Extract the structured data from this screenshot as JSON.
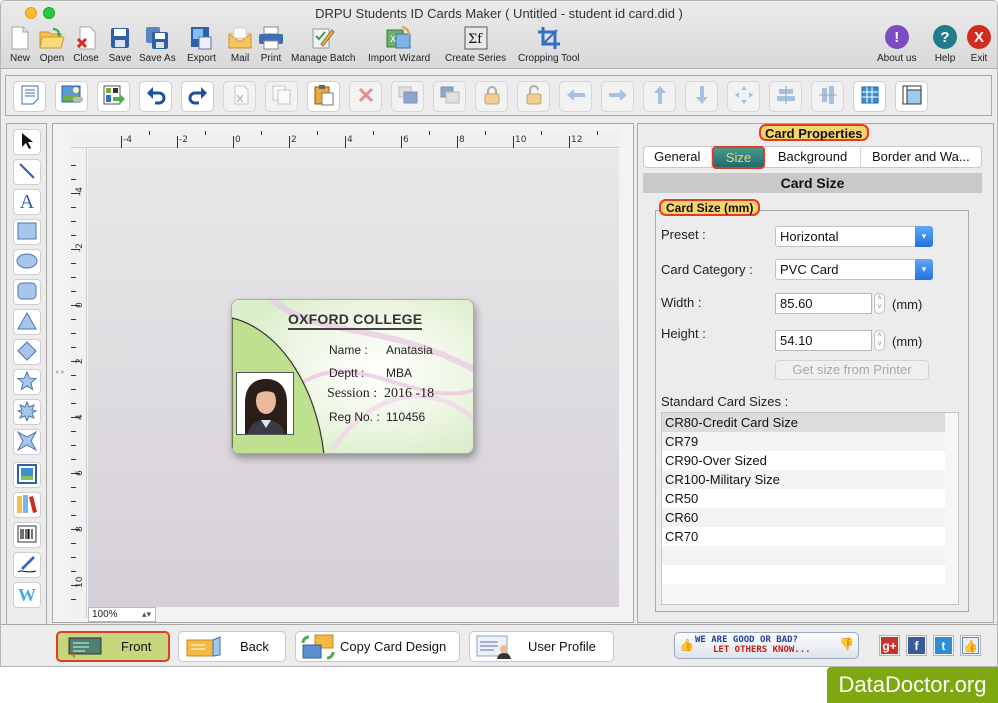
{
  "window": {
    "title": "DRPU Students ID Cards Maker ( Untitled - student id card.did )"
  },
  "main_toolbar": {
    "items": [
      {
        "label": "New",
        "icon": "new-document-icon"
      },
      {
        "label": "Open",
        "icon": "open-folder-icon"
      },
      {
        "label": "Close",
        "icon": "close-document-icon"
      },
      {
        "label": "Save",
        "icon": "save-icon"
      },
      {
        "label": "Save As",
        "icon": "save-as-icon"
      },
      {
        "label": "Export",
        "icon": "export-icon"
      },
      {
        "label": "Mail",
        "icon": "mail-icon"
      },
      {
        "label": "Print",
        "icon": "printer-icon"
      },
      {
        "label": "Manage Batch",
        "icon": "manage-batch-icon"
      },
      {
        "label": "Import Wizard",
        "icon": "import-wizard-icon"
      },
      {
        "label": "Create Series",
        "icon": "create-series-icon"
      },
      {
        "label": "Cropping Tool",
        "icon": "crop-icon"
      }
    ],
    "right_items": [
      {
        "label": "About us",
        "glyph": "!",
        "color": "#7d4cc2"
      },
      {
        "label": "Help",
        "glyph": "?",
        "color": "#237c8e"
      },
      {
        "label": "Exit",
        "glyph": "X",
        "color": "#d12b1f"
      }
    ]
  },
  "edit_toolbar": {
    "buttons": [
      {
        "name": "properties",
        "icon": "properties-icon",
        "enabled": true
      },
      {
        "name": "insert-image",
        "icon": "image-icon",
        "enabled": true
      },
      {
        "name": "export-design",
        "icon": "export-design-icon",
        "enabled": true
      },
      {
        "name": "undo",
        "icon": "undo-icon",
        "enabled": true
      },
      {
        "name": "redo",
        "icon": "redo-icon",
        "enabled": true
      },
      {
        "name": "cut",
        "icon": "cut-icon",
        "enabled": false
      },
      {
        "name": "copy",
        "icon": "copy-icon",
        "enabled": false
      },
      {
        "name": "paste",
        "icon": "paste-icon",
        "enabled": true
      },
      {
        "name": "delete",
        "icon": "delete-icon",
        "enabled": false
      },
      {
        "name": "bring-to-front",
        "icon": "bring-front-icon",
        "enabled": false
      },
      {
        "name": "send-to-back",
        "icon": "send-back-icon",
        "enabled": false
      },
      {
        "name": "lock",
        "icon": "lock-icon",
        "enabled": false
      },
      {
        "name": "unlock",
        "icon": "unlock-icon",
        "enabled": false
      },
      {
        "name": "move-left",
        "icon": "arrow-left-icon",
        "enabled": false
      },
      {
        "name": "move-right",
        "icon": "arrow-right-icon",
        "enabled": false
      },
      {
        "name": "move-up",
        "icon": "arrow-up-icon",
        "enabled": false
      },
      {
        "name": "move-down",
        "icon": "arrow-down-icon",
        "enabled": false
      },
      {
        "name": "center",
        "icon": "center-icon",
        "enabled": false
      },
      {
        "name": "align-horizontal",
        "icon": "align-horizontal-icon",
        "enabled": false
      },
      {
        "name": "align-vertical",
        "icon": "align-vertical-icon",
        "enabled": false
      },
      {
        "name": "grid",
        "icon": "grid-icon",
        "enabled": true
      },
      {
        "name": "ruler",
        "icon": "ruler-icon",
        "enabled": true
      }
    ]
  },
  "tools": [
    "pointer",
    "line",
    "text",
    "rectangle",
    "ellipse",
    "rounded-rectangle",
    "triangle",
    "diamond",
    "star",
    "burst",
    "four-point-star",
    "picture",
    "library",
    "barcode",
    "signature",
    "watermark"
  ],
  "canvas": {
    "ruler_h_labels": [
      "-4",
      "-2",
      "0",
      "2",
      "4",
      "6",
      "8",
      "10",
      "12"
    ],
    "ruler_v_labels": [
      "-4",
      "-2",
      "0",
      "2",
      "4",
      "6",
      "8",
      "10"
    ],
    "zoom": "100%"
  },
  "card": {
    "title": "OXFORD COLLEGE",
    "rows": [
      {
        "label": "Name :",
        "value": "Anatasia"
      },
      {
        "label": "Deptt :",
        "value": "MBA"
      },
      {
        "label": "Session :",
        "value": "2016 -18"
      },
      {
        "label": "Reg No. :",
        "value": "110456"
      }
    ]
  },
  "properties": {
    "title": "Card Properties",
    "tabs": [
      "General",
      "Size",
      "Background",
      "Border and Wa..."
    ],
    "active_tab": "Size",
    "section": "Card Size",
    "group_title": "Card Size (mm)",
    "preset": {
      "label": "Preset :",
      "value": "Horizontal"
    },
    "category": {
      "label": "Card Category :",
      "value": "PVC Card"
    },
    "width": {
      "label": "Width :",
      "value": "85.60",
      "unit": "(mm)"
    },
    "height": {
      "label": "Height :",
      "value": "54.10",
      "unit": "(mm)"
    },
    "printer_button": "Get size from Printer",
    "standard_label": "Standard Card Sizes :",
    "standard_sizes": [
      "CR80-Credit Card Size",
      "CR79",
      "CR90-Over Sized",
      "CR100-Military Size",
      "CR50",
      "CR60",
      "CR70"
    ],
    "selected_size": "CR80-Credit Card Size"
  },
  "bottom": {
    "buttons": [
      {
        "label": "Front",
        "active": true
      },
      {
        "label": "Back",
        "active": false
      },
      {
        "label": "Copy Card Design",
        "active": false
      },
      {
        "label": "User Profile",
        "active": false
      }
    ],
    "feedback_line1": "WE ARE GOOD OR BAD?",
    "feedback_line2": "LET OTHERS KNOW...",
    "social": [
      {
        "name": "google-plus",
        "glyph": "g+",
        "color": "#c9302c"
      },
      {
        "name": "facebook",
        "glyph": "f",
        "color": "#3b5998"
      },
      {
        "name": "twitter",
        "glyph": "t",
        "color": "#2a8fd6"
      },
      {
        "name": "like",
        "glyph": "👍",
        "color": "#5a86c9"
      }
    ]
  },
  "watermark": "DataDoctor.org"
}
